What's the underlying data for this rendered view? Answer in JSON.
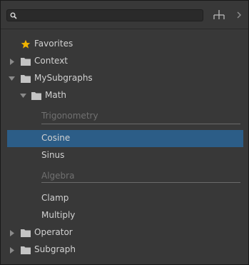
{
  "search": {
    "value": "",
    "placeholder": ""
  },
  "tree": {
    "favorites": "Favorites",
    "context": "Context",
    "mysubgraphs": "MySubgraphs",
    "math": "Math",
    "section_trig": "Trigonometry",
    "cosine": "Cosine",
    "sinus": "Sinus",
    "section_algebra": "Algebra",
    "clamp": "Clamp",
    "multiply": "Multiply",
    "operator": "Operator",
    "subgraph": "Subgraph"
  },
  "icons": {
    "search": "search-icon",
    "hierarchy": "hierarchy-icon",
    "expand": "chevron-right-icon",
    "folder": "folder-icon",
    "star": "star-icon"
  },
  "colors": {
    "panel_bg": "#383838",
    "selection": "#2c5d87",
    "star": "#f0b400",
    "muted_text": "#717171"
  }
}
